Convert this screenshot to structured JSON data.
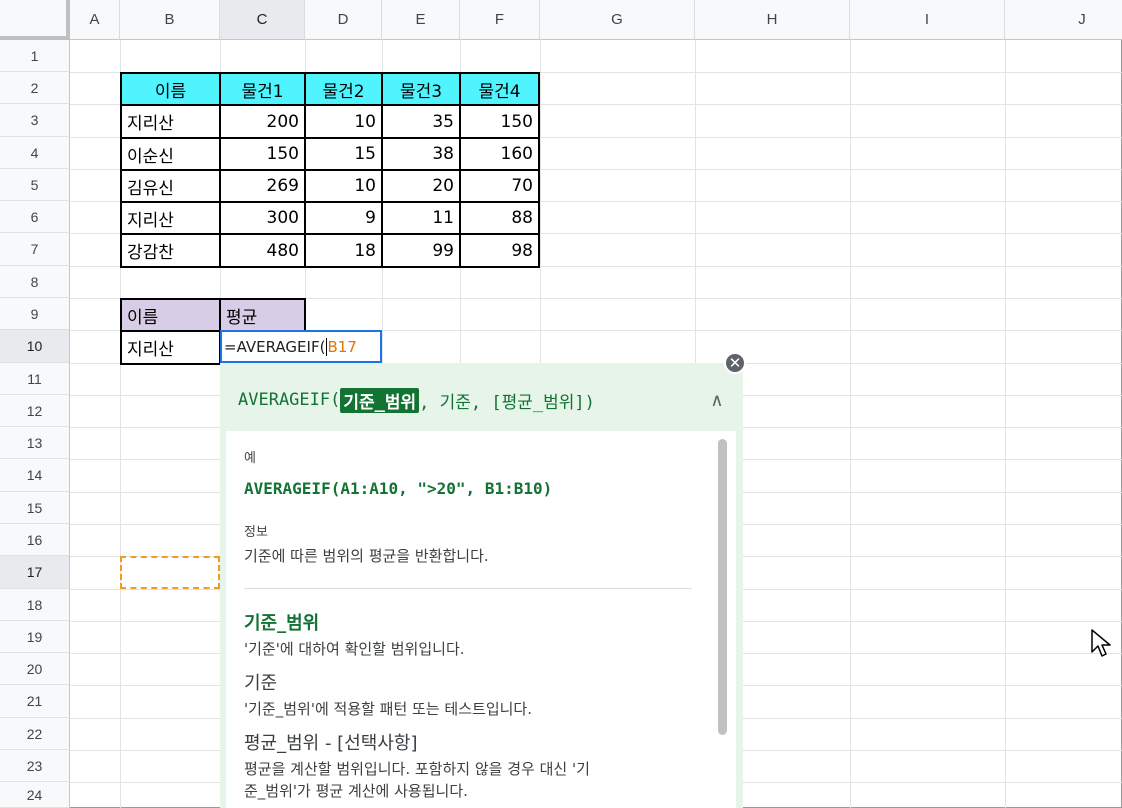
{
  "columns": [
    "A",
    "B",
    "C",
    "D",
    "E",
    "F",
    "G",
    "H",
    "I",
    "J"
  ],
  "rows": [
    "1",
    "2",
    "3",
    "4",
    "5",
    "6",
    "7",
    "8",
    "9",
    "10",
    "11",
    "12",
    "13",
    "14",
    "15",
    "16",
    "17",
    "18",
    "19",
    "20",
    "21",
    "22",
    "23",
    "24"
  ],
  "table1": {
    "headers": [
      "이름",
      "물건1",
      "물건2",
      "물건3",
      "물건4"
    ],
    "rows": [
      [
        "지리산",
        "200",
        "10",
        "35",
        "150"
      ],
      [
        "이순신",
        "150",
        "15",
        "38",
        "160"
      ],
      [
        "김유신",
        "269",
        "10",
        "20",
        "70"
      ],
      [
        "지리산",
        "300",
        "9",
        "11",
        "88"
      ],
      [
        "강감찬",
        "480",
        "18",
        "99",
        "98"
      ]
    ]
  },
  "table2": {
    "headers": [
      "이름",
      "평균"
    ],
    "name": "지리산",
    "formula_prefix": "=AVERAGEIF(",
    "formula_ref": "B17"
  },
  "help": {
    "signature_func": "AVERAGEIF(",
    "signature_arg_active": "기준_범위",
    "signature_rest": ", 기준, [평균_범위])",
    "collapse_icon": "∧",
    "close_icon": "✕",
    "example_label": "예",
    "example": "AVERAGEIF(A1:A10, \">20\", B1:B10)",
    "info_label": "정보",
    "info_text": "기준에 따른 범위의 평균을 반환합니다.",
    "args": [
      {
        "title": "기준_범위",
        "desc": "'기준'에 대하여 확인할 범위입니다."
      },
      {
        "title": "기준",
        "desc": "'기준_범위'에 적용할 패턴 또는 테스트입니다."
      },
      {
        "title": "평균_범위  - [선택사항]",
        "desc": "평균을 계산할 범위입니다. 포함하지 않을 경우 대신 '기",
        "desc2": "준_범위'가 평균 계산에 사용됩니다."
      }
    ]
  },
  "colors": {
    "header_cyan": "#4ff4ff",
    "header_purple": "#d8cde6",
    "accent_green": "#137333",
    "active_blue": "#1a73e8",
    "ref_orange": "#f29c1f"
  }
}
